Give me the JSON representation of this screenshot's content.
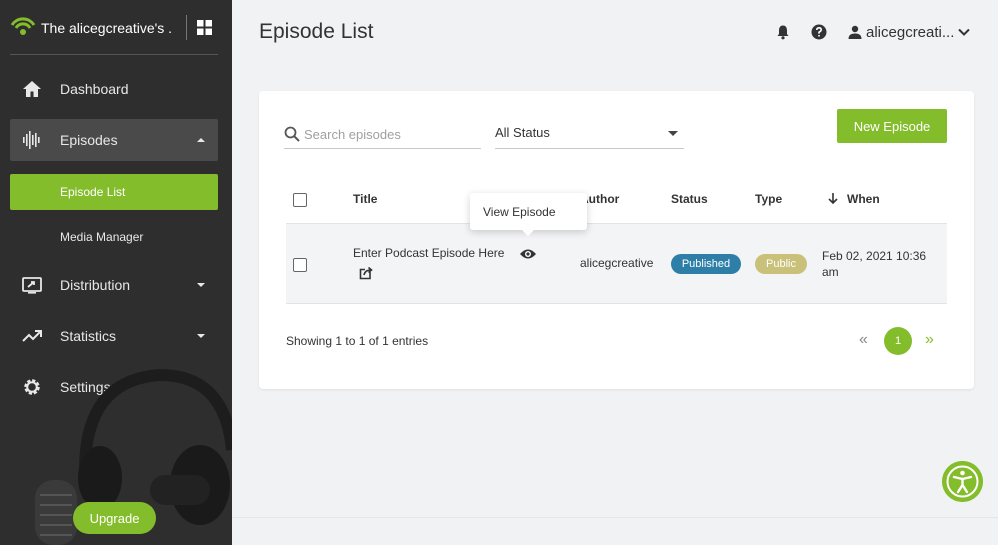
{
  "sidebar": {
    "app_title": "The alicegcreative's ...",
    "items": [
      {
        "label": "Dashboard"
      },
      {
        "label": "Episodes"
      },
      {
        "label": "Distribution"
      },
      {
        "label": "Statistics"
      },
      {
        "label": "Settings"
      }
    ],
    "sub_items": [
      {
        "label": "Episode List"
      },
      {
        "label": "Media Manager"
      }
    ],
    "upgrade_label": "Upgrade"
  },
  "header": {
    "title": "Episode List",
    "user": "alicegcreati..."
  },
  "toolbar": {
    "search_placeholder": "Search episodes",
    "status_value": "All Status",
    "new_episode_label": "New Episode"
  },
  "table": {
    "headers": {
      "title": "Title",
      "author": "Author",
      "status": "Status",
      "type": "Type",
      "when": "When"
    },
    "rows": [
      {
        "title": "Enter Podcast Episode Here",
        "author": "alicegcreative",
        "status": "Published",
        "type": "Public",
        "when": "Feb 02, 2021 10:36 am"
      }
    ],
    "tooltip": "View Episode"
  },
  "footer": {
    "entries_text": "Showing 1 to 1 of 1 entries",
    "current_page": "1",
    "prev_label": "«",
    "next_label": "»"
  },
  "colors": {
    "accent": "#84bd2b",
    "sidebar_bg": "#2e2e2e",
    "published_badge": "#2e7fa8",
    "public_badge": "#c9c07a"
  }
}
